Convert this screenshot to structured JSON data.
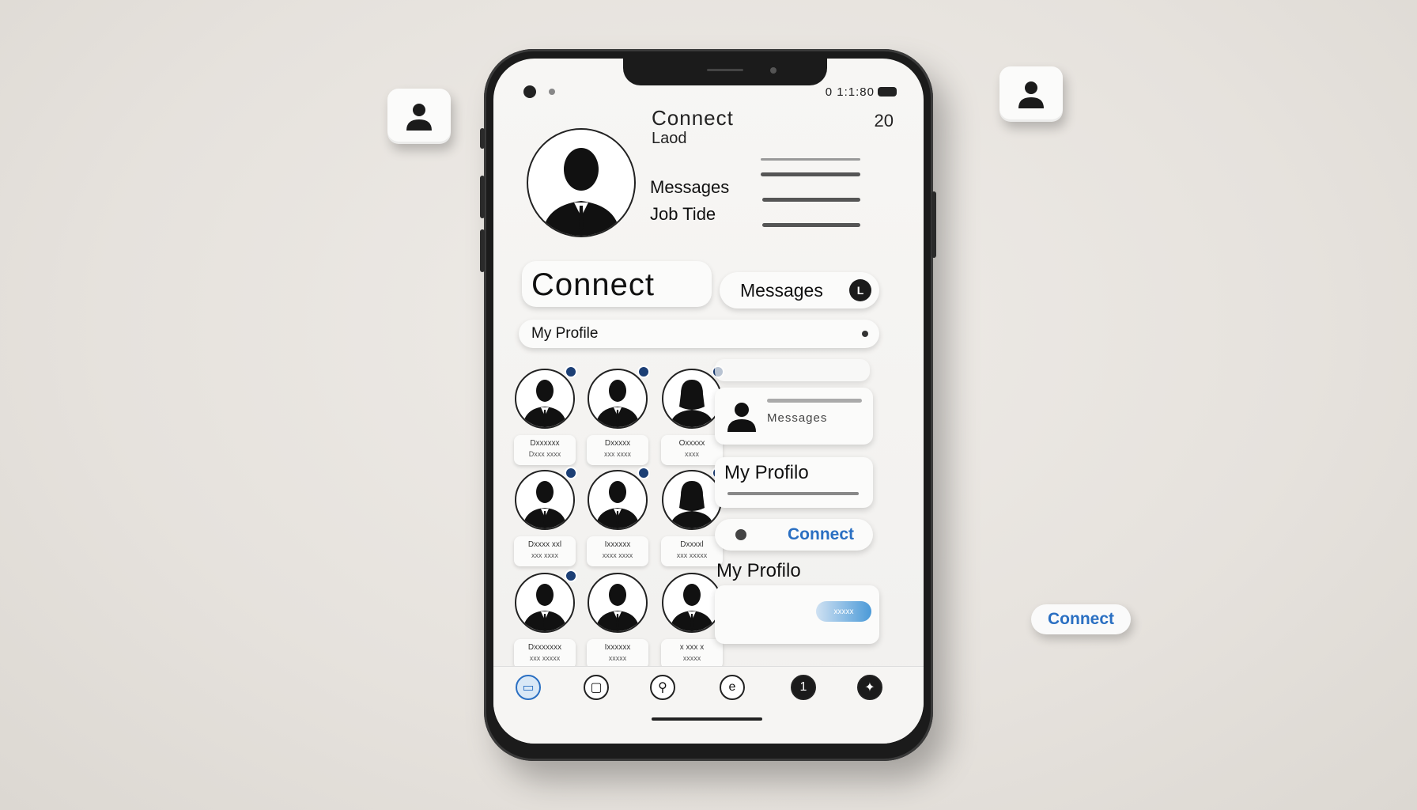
{
  "header": {
    "title": "Connect",
    "subtitle": "Laod",
    "count": "20",
    "labels": [
      "Messages",
      "Job Tide"
    ]
  },
  "status_bar": {
    "time": "0 1:1:80"
  },
  "actions": {
    "connect_label": "Connect",
    "messages_label": "Messages",
    "messages_badge": "L",
    "profile_label": "My Profile"
  },
  "contacts": [
    {
      "name": "Dxxxxxx",
      "title": "Dxxx xxxx"
    },
    {
      "name": "Dxxxxx",
      "title": "xxx xxxx"
    },
    {
      "name": "Oxxxxx",
      "title": "xxxx"
    },
    {
      "name": "Dxxxx xxl",
      "title": "xxx xxxx"
    },
    {
      "name": "Ixxxxxx",
      "title": "xxxx xxxx"
    },
    {
      "name": "Dxxxxl",
      "title": "xxx xxxxx"
    },
    {
      "name": "Dxxxxxxx",
      "title": "xxx xxxxx"
    },
    {
      "name": "Ixxxxxx",
      "title": "xxxxx"
    },
    {
      "name": "x xxx x",
      "title": "xxxxx"
    }
  ],
  "right_panel": {
    "message_card_label": "Messages",
    "profile_card_label": "My Profilo",
    "connect_button_label": "Connect",
    "profile_section_label": "My Profilo",
    "profile_button_label": "xxxxx"
  },
  "floating": {
    "connect_pill_label": "Connect"
  },
  "tabs": [
    {
      "icon": "home-icon"
    },
    {
      "icon": "briefcase-icon"
    },
    {
      "icon": "search-icon"
    },
    {
      "icon": "chat-icon"
    },
    {
      "icon": "notification-icon"
    },
    {
      "icon": "globe-icon"
    }
  ],
  "colors": {
    "accent": "#2a6fc2",
    "dark": "#1b1b1b",
    "background": "#e9e6e2"
  }
}
